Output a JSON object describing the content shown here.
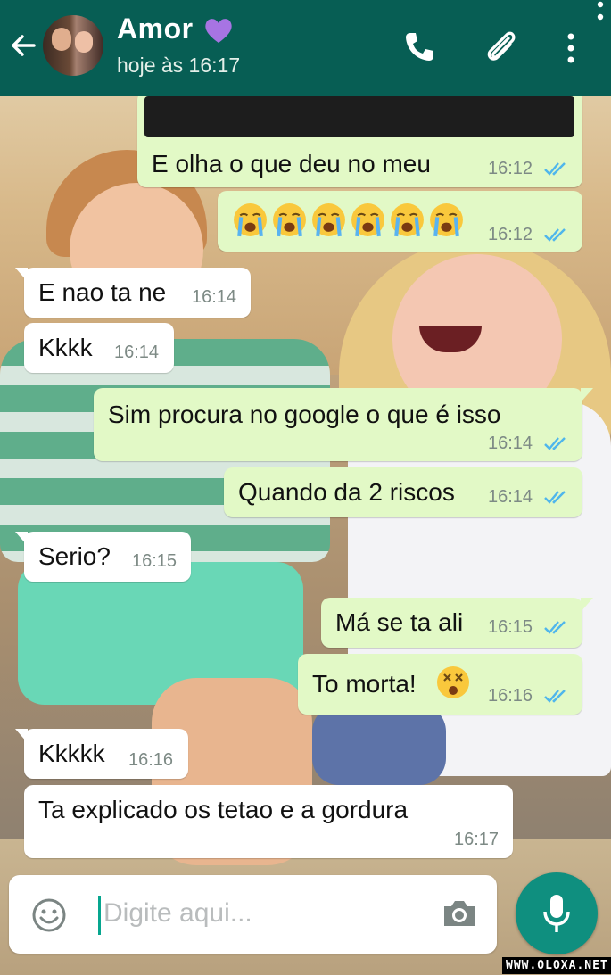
{
  "header": {
    "contact_name": "Amor",
    "name_emoji": "purple-heart",
    "last_seen": "hoje às 16:17",
    "colors": {
      "bar": "#075e54"
    }
  },
  "messages": [
    {
      "dir": "out",
      "text": "E olha o que deu no meu",
      "time": "16:12",
      "ticks": "double-blue"
    },
    {
      "dir": "out",
      "emoji": "loudly-crying-face x6",
      "time": "16:12",
      "ticks": "double-blue"
    },
    {
      "dir": "in",
      "text": "E nao ta ne",
      "time": "16:14"
    },
    {
      "dir": "in",
      "text": "Kkkk",
      "time": "16:14"
    },
    {
      "dir": "out",
      "text": "Sim procura no google o que é isso",
      "time": "16:14",
      "ticks": "double-blue"
    },
    {
      "dir": "out",
      "text": "Quando da 2 riscos",
      "time": "16:14",
      "ticks": "double-blue"
    },
    {
      "dir": "in",
      "text": "Serio?",
      "time": "16:15"
    },
    {
      "dir": "out",
      "text": "Má se ta ali",
      "time": "16:15",
      "ticks": "double-blue"
    },
    {
      "dir": "out",
      "text": "To morta!",
      "emoji": "dizzy-face",
      "time": "16:16",
      "ticks": "double-blue"
    },
    {
      "dir": "in",
      "text": "Kkkkk",
      "time": "16:16"
    },
    {
      "dir": "in",
      "text": "Ta explicado os tetao e a gordura",
      "time": "16:17"
    }
  ],
  "composer": {
    "placeholder": "Digite aqui..."
  },
  "watermark": "WWW.OLOXA.NET",
  "colors": {
    "outgoing_bubble": "#e2f9c6",
    "incoming_bubble": "#ffffff",
    "read_ticks": "#4fb6ec",
    "mic_button": "#0f8f7f"
  }
}
